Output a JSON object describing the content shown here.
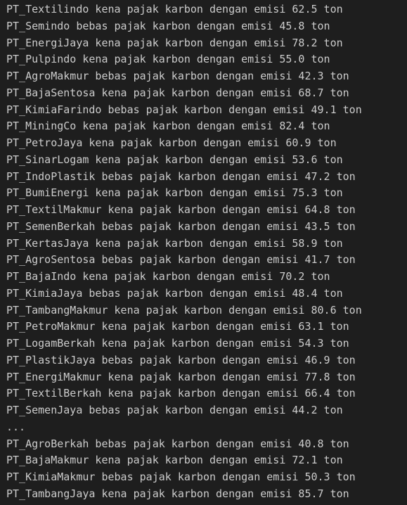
{
  "terminal": {
    "lines": [
      "PT_Textilindo kena pajak karbon dengan emisi 62.5 ton",
      "PT_Semindo bebas pajak karbon dengan emisi 45.8 ton",
      "PT_EnergiJaya kena pajak karbon dengan emisi 78.2 ton",
      "PT_Pulpindo kena pajak karbon dengan emisi 55.0 ton",
      "PT_AgroMakmur bebas pajak karbon dengan emisi 42.3 ton",
      "PT_BajaSentosa kena pajak karbon dengan emisi 68.7 ton",
      "PT_KimiaFarindo bebas pajak karbon dengan emisi 49.1 ton",
      "PT_MiningCo kena pajak karbon dengan emisi 82.4 ton",
      "PT_PetroJaya kena pajak karbon dengan emisi 60.9 ton",
      "PT_SinarLogam kena pajak karbon dengan emisi 53.6 ton",
      "PT_IndoPlastik bebas pajak karbon dengan emisi 47.2 ton",
      "PT_BumiEnergi kena pajak karbon dengan emisi 75.3 ton",
      "PT_TextilMakmur kena pajak karbon dengan emisi 64.8 ton",
      "PT_SemenBerkah bebas pajak karbon dengan emisi 43.5 ton",
      "PT_KertasJaya kena pajak karbon dengan emisi 58.9 ton",
      "PT_AgroSentosa bebas pajak karbon dengan emisi 41.7 ton",
      "PT_BajaIndo kena pajak karbon dengan emisi 70.2 ton",
      "PT_KimiaJaya bebas pajak karbon dengan emisi 48.4 ton",
      "PT_TambangMakmur kena pajak karbon dengan emisi 80.6 ton",
      "PT_PetroMakmur kena pajak karbon dengan emisi 63.1 ton",
      "PT_LogamBerkah kena pajak karbon dengan emisi 54.3 ton",
      "PT_PlastikJaya bebas pajak karbon dengan emisi 46.9 ton",
      "PT_EnergiMakmur kena pajak karbon dengan emisi 77.8 ton",
      "PT_TextilBerkah kena pajak karbon dengan emisi 66.4 ton",
      "PT_SemenJaya bebas pajak karbon dengan emisi 44.2 ton",
      "...",
      "PT_AgroBerkah bebas pajak karbon dengan emisi 40.8 ton",
      "PT_BajaMakmur kena pajak karbon dengan emisi 72.1 ton",
      "PT_KimiaMakmur bebas pajak karbon dengan emisi 50.3 ton",
      "PT_TambangJaya kena pajak karbon dengan emisi 85.7 ton"
    ]
  },
  "colors": {
    "background": "#1e1e1e",
    "text": "#cccccc"
  }
}
